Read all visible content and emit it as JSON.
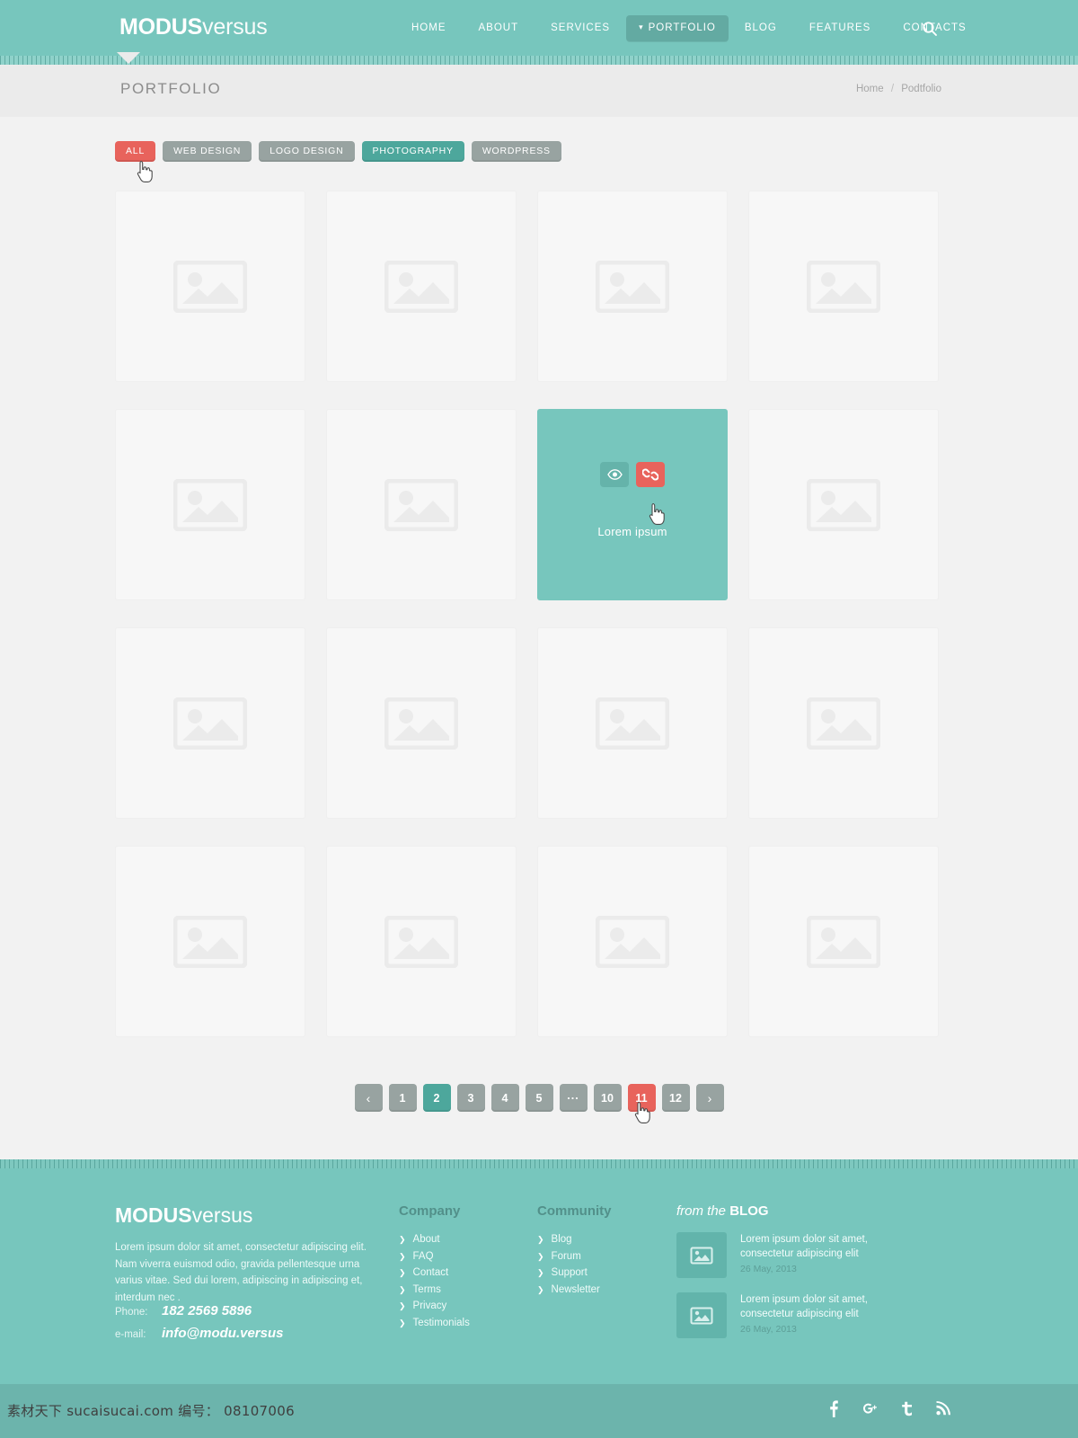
{
  "header": {
    "logo_bold": "MODUS",
    "logo_light": "versus",
    "nav": [
      {
        "label": "HOME",
        "active": false
      },
      {
        "label": "ABOUT",
        "active": false
      },
      {
        "label": "SERVICES",
        "active": false
      },
      {
        "label": "PORTFOLIO",
        "active": true
      },
      {
        "label": "BLOG",
        "active": false
      },
      {
        "label": "FEATURES",
        "active": false
      },
      {
        "label": "CONTACTS",
        "active": false
      }
    ],
    "search_icon": "search-icon",
    "bg_color": "#77c6bd",
    "active_bg_color": "#63aaa2"
  },
  "titlebar": {
    "title": "PORTFOLIO",
    "breadcrumb_home": "Home",
    "breadcrumb_sep": "/",
    "breadcrumb_current": "Podtfolio"
  },
  "filters": {
    "items": [
      {
        "label": "ALL",
        "state": "hover",
        "color": "#e8635c"
      },
      {
        "label": "WEB DESIGN",
        "state": "normal",
        "color": "#98a3a1"
      },
      {
        "label": "LOGO DESIGN",
        "state": "normal",
        "color": "#98a3a1"
      },
      {
        "label": "PHOTOGRAPHY",
        "state": "selected",
        "color": "#4da79c"
      },
      {
        "label": "WORDPRESS",
        "state": "normal",
        "color": "#98a3a1"
      }
    ]
  },
  "portfolio": {
    "placeholder_icon": "image-placeholder-icon",
    "hovered_index": 6,
    "hovered_caption": "Lorem ipsum",
    "hover_actions": [
      {
        "name": "preview-icon",
        "color": "#65b3aa"
      },
      {
        "name": "link-icon",
        "color": "#e8635c"
      }
    ],
    "items": [
      {
        "caption": ""
      },
      {
        "caption": ""
      },
      {
        "caption": ""
      },
      {
        "caption": ""
      },
      {
        "caption": ""
      },
      {
        "caption": ""
      },
      {
        "caption": "Lorem ipsum"
      },
      {
        "caption": ""
      },
      {
        "caption": ""
      },
      {
        "caption": ""
      },
      {
        "caption": ""
      },
      {
        "caption": ""
      },
      {
        "caption": ""
      },
      {
        "caption": ""
      },
      {
        "caption": ""
      },
      {
        "caption": ""
      }
    ]
  },
  "pagination": {
    "prev_label": "‹",
    "next_label": "›",
    "pages": [
      {
        "label": "1",
        "state": "normal"
      },
      {
        "label": "2",
        "state": "current"
      },
      {
        "label": "3",
        "state": "normal"
      },
      {
        "label": "4",
        "state": "normal"
      },
      {
        "label": "5",
        "state": "normal"
      },
      {
        "label": "...",
        "state": "dots"
      },
      {
        "label": "10",
        "state": "normal"
      },
      {
        "label": "11",
        "state": "hover"
      },
      {
        "label": "12",
        "state": "normal"
      }
    ]
  },
  "footer": {
    "logo_bold": "MODUS",
    "logo_light": "versus",
    "about": "Lorem ipsum dolor sit amet, consectetur adipiscing elit. Nam viverra euismod odio, gravida pellentesque urna varius vitae. Sed dui lorem, adipiscing in adipiscing et, interdum nec .",
    "phone_label": "Phone:",
    "phone_value": "182 2569 5896",
    "email_label": "e-mail:",
    "email_value": "info@modu.versus",
    "company": {
      "heading": "Company",
      "links": [
        "About",
        "FAQ",
        "Contact",
        "Terms",
        "Privacy",
        "Testimonials"
      ]
    },
    "community": {
      "heading": "Community",
      "links": [
        "Blog",
        "Forum",
        "Support",
        "Newsletter"
      ]
    },
    "blog": {
      "heading_italic": "from the",
      "heading_bold": "BLOG",
      "posts": [
        {
          "title": "Lorem ipsum dolor sit amet, consectetur adipiscing elit",
          "date": "26 May, 2013",
          "thumb_icon": "image-placeholder-icon"
        },
        {
          "title": "Lorem ipsum dolor sit amet, consectetur adipiscing elit",
          "date": "26 May, 2013",
          "thumb_icon": "image-placeholder-icon"
        }
      ]
    },
    "bg_color": "#77c6bd"
  },
  "bottombar": {
    "watermark": "素材天下 sucaisucai.com 编号： 08107006",
    "socials": [
      {
        "name": "facebook-icon",
        "glyph": "f"
      },
      {
        "name": "googleplus-icon",
        "glyph": "g+"
      },
      {
        "name": "twitter-icon",
        "glyph": "t"
      },
      {
        "name": "rss-icon",
        "glyph": "rss"
      }
    ],
    "bg_color": "#6cb4ac"
  }
}
